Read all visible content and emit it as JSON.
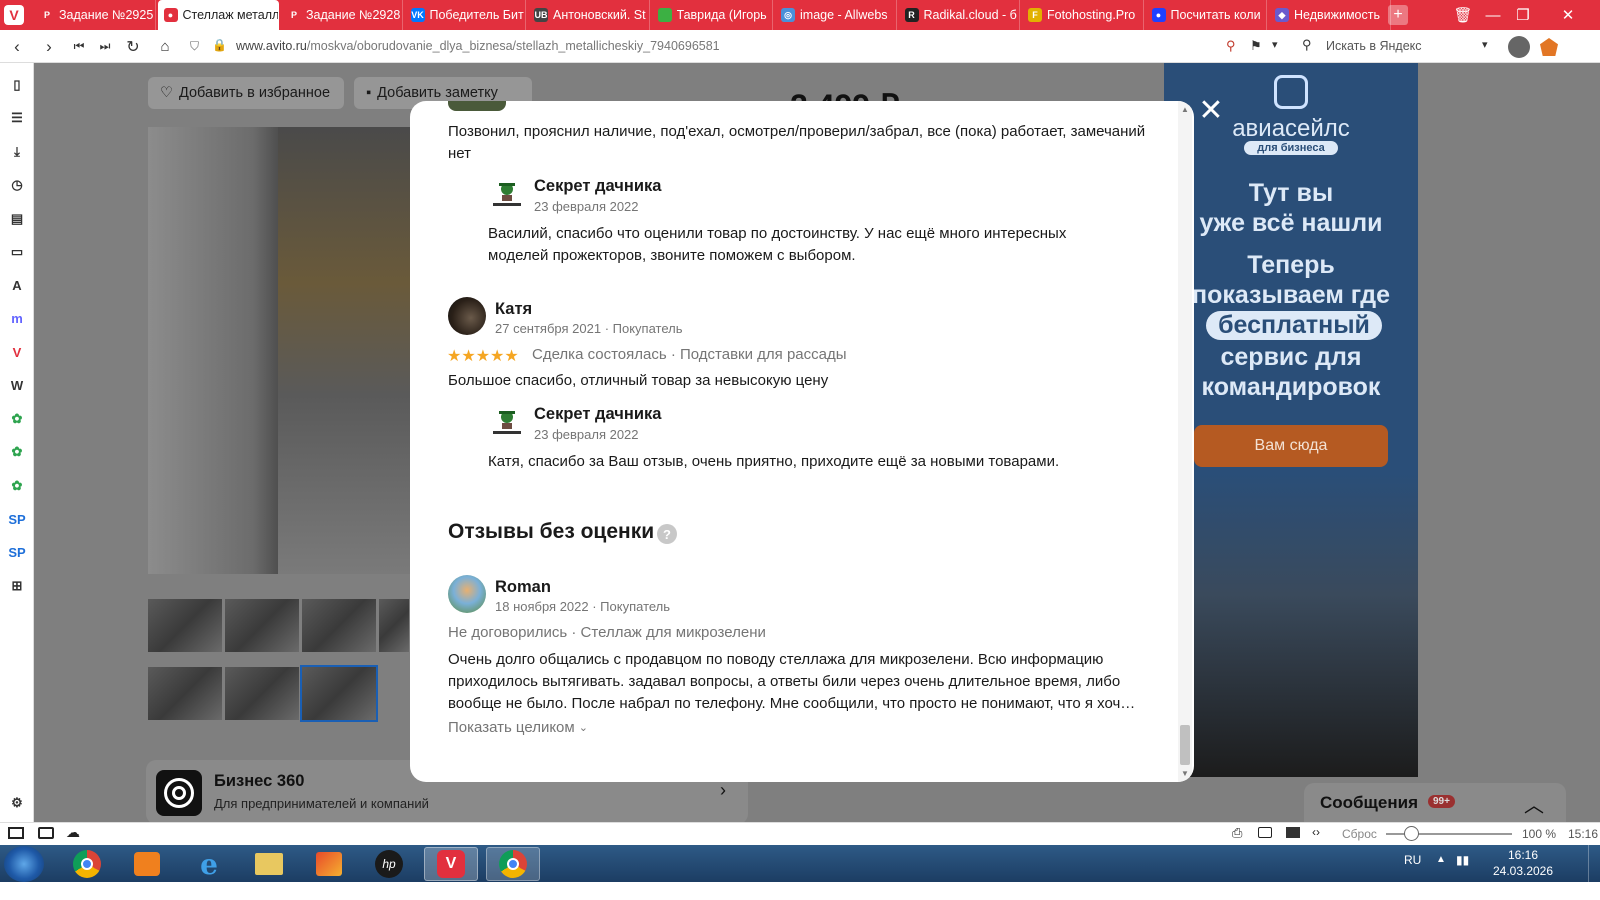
{
  "browser": {
    "tabs": [
      {
        "label": "Задание №2925",
        "color": "#e2303e",
        "glyph": "P"
      },
      {
        "label": "Стеллаж металл",
        "color": "#e2303e",
        "glyph": "●",
        "active": true
      },
      {
        "label": "Задание №2928",
        "color": "#e2303e",
        "glyph": "P"
      },
      {
        "label": "Победитель Бит",
        "color": "#0077ff",
        "glyph": "VK"
      },
      {
        "label": "Антоновский. St",
        "color": "#444",
        "glyph": "UB"
      },
      {
        "label": "Таврида (Игорь",
        "color": "#3cb043",
        "glyph": ""
      },
      {
        "label": "image - Allwebs",
        "color": "#4a90d9",
        "glyph": "◎"
      },
      {
        "label": "Radikal.cloud - б",
        "color": "#222",
        "glyph": "R"
      },
      {
        "label": "Fotohosting.Pro",
        "color": "#e2b100",
        "glyph": "F"
      },
      {
        "label": "Посчитать коли",
        "color": "#1e40ff",
        "glyph": "●"
      },
      {
        "label": "Недвижимость",
        "color": "#6a5acd",
        "glyph": "◆"
      }
    ],
    "url_host": "www.avito.ru",
    "url_path": "/moskva/oborudovanie_dlya_biznesa/stellazh_metallicheskiy_7940696581",
    "search_placeholder": "Искать в Яндекс",
    "left_panel": [
      "bookmark-icon",
      "reader-icon",
      "download-icon",
      "history-icon",
      "notes-icon",
      "wallet-icon",
      "translate-icon",
      "mastodon-icon",
      "vivaldi-icon",
      "wikipedia-icon",
      "app-icon",
      "app-icon",
      "app-icon",
      "sp-icon",
      "sp-icon",
      "add-panel-icon"
    ]
  },
  "page": {
    "favorite_button": "Добавить в избранное",
    "note_button": "Добавить заметку",
    "price_partial": "2 499 ₽",
    "business": {
      "title": "Бизнес 360",
      "subtitle": "Для предпринимателей и компаний"
    },
    "ad": {
      "brand": "авиасейлс",
      "brand_sub": "для бизнеса",
      "line1": "Тут вы",
      "line2": "уже всё нашли",
      "line3": "Теперь",
      "line4": "показываем где",
      "highlight": "бесплатный",
      "line5": "сервис для",
      "line6": "командировок",
      "cta": "Вам сюда"
    },
    "messages": {
      "label": "Сообщения",
      "badge": "99+"
    }
  },
  "modal": {
    "review0": {
      "text": "Позвонил, прояснил наличие, под'ехал, осмотрел/проверил/забрал, все (пока) работает, замечаний нет",
      "reply": {
        "shop": "Секрет дачника",
        "date": "23 февраля 2022",
        "text": "Василий, спасибо что оценили товар по достоинству. У нас ещё много интересных моделей прожекторов, звоните поможем с выбором."
      }
    },
    "review1": {
      "author": "Катя",
      "meta": "27 сентября 2021 · Покупатель",
      "stars": "★★★★★",
      "tags": "Сделка состоялась · Подставки для рассады",
      "text": "Большое спасибо, отличный товар за невысокую цену",
      "reply": {
        "shop": "Секрет дачника",
        "date": "23 февраля 2022",
        "text": "Катя, спасибо за Ваш отзыв, очень приятно, приходите ещё за новыми товарами."
      }
    },
    "unrated_heading": "Отзывы без оценки",
    "review2": {
      "author": "Roman",
      "meta": "18 ноября 2022 · Покупатель",
      "tags": "Не договорились · Стеллаж для микрозелени",
      "text": "Очень долго общались с продавцом по поводу стеллажа для микрозелени. Всю информацию приходилось вытягивать. задавал вопросы, а ответы били через очень длительное время, либо вообще не было. После набрал по телефону. Мне сообщили, что просто не понимают, что я хоч…",
      "show_more": "Показать целиком"
    }
  },
  "statusbar": {
    "reset": "Сброс",
    "zoom": "100 %",
    "clock": "15:16"
  },
  "taskbar": {
    "lang": "RU",
    "time": "16:16",
    "date": "24.03.2026"
  }
}
